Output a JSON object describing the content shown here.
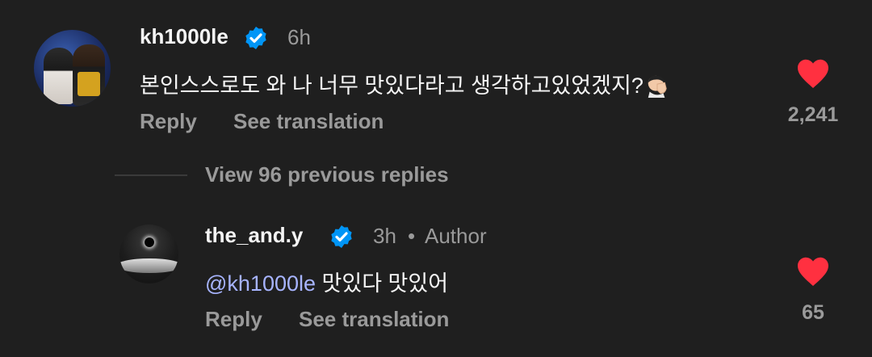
{
  "comment": {
    "username": "kh1000le",
    "time": "6h",
    "text": "본인스스로도 와 나 너무 맛있다라고 생각하고있었겠지?",
    "emoji": "face-palm-emoji",
    "reply_label": "Reply",
    "translate_label": "See translation",
    "likes": "2,241"
  },
  "view_previous": "View 96 previous replies",
  "reply": {
    "username": "the_and.y",
    "time": "3h",
    "separator": "•",
    "badge": "Author",
    "mention": "@kh1000le",
    "text": "맛있다 맛있어",
    "reply_label": "Reply",
    "translate_label": "See translation",
    "likes": "65"
  },
  "colors": {
    "background": "#1f1f1f",
    "heart": "#ff3040",
    "verified": "#0095f6",
    "mention": "#a7b4ff",
    "muted": "#9a9a9a"
  },
  "icons": [
    "verified-badge-icon",
    "heart-icon",
    "threads-at-icon"
  ]
}
